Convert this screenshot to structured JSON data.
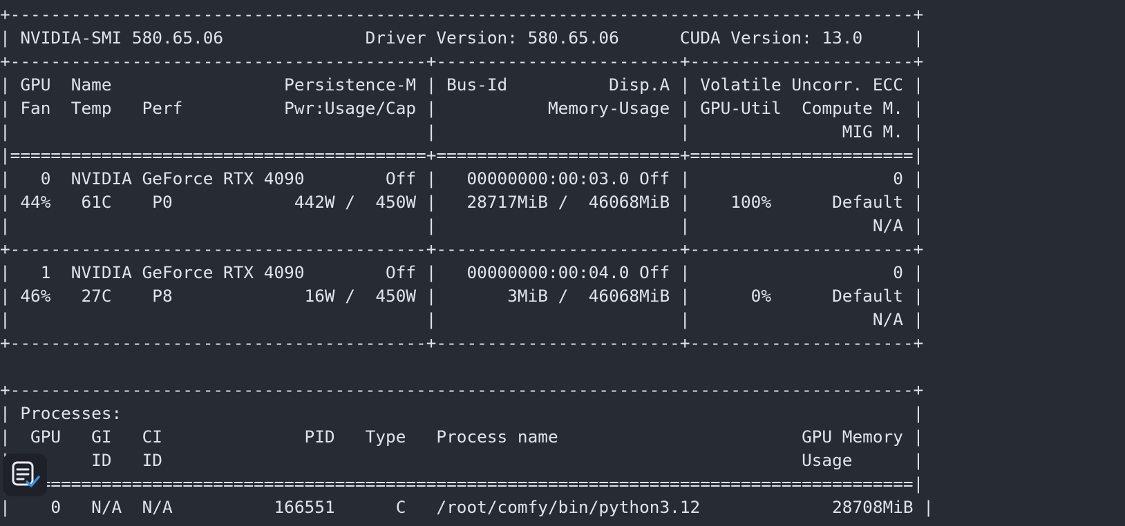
{
  "terminal": {
    "lines": [
      "+-----------------------------------------------------------------------------------------+",
      "| NVIDIA-SMI 580.65.06              Driver Version: 580.65.06      CUDA Version: 13.0     |",
      "+-----------------------------------------+------------------------+----------------------+",
      "| GPU  Name                 Persistence-M | Bus-Id          Disp.A | Volatile Uncorr. ECC |",
      "| Fan  Temp   Perf          Pwr:Usage/Cap |           Memory-Usage | GPU-Util  Compute M. |",
      "|                                         |                        |               MIG M. |",
      "|=========================================+========================+======================|",
      "|   0  NVIDIA GeForce RTX 4090        Off |   00000000:00:03.0 Off |                    0 |",
      "| 44%   61C    P0            442W /  450W |   28717MiB /  46068MiB |    100%      Default |",
      "|                                         |                        |                  N/A |",
      "+-----------------------------------------+------------------------+----------------------+",
      "|   1  NVIDIA GeForce RTX 4090        Off |   00000000:00:04.0 Off |                    0 |",
      "| 46%   27C    P8             16W /  450W |       3MiB /  46068MiB |      0%      Default |",
      "|                                         |                        |                  N/A |",
      "+-----------------------------------------+------------------------+----------------------+",
      "",
      "+-----------------------------------------------------------------------------------------+",
      "| Processes:                                                                              |",
      "|  GPU   GI   CI              PID   Type   Process name                        GPU Memory |",
      "|        ID   ID                                                               Usage      |",
      "|=========================================================================================|",
      "|    0   N/A  N/A          166551      C   /root/comfy/bin/python3.12             28708MiB |",
      "+-----------------------------------------------------------------------------------------+"
    ]
  },
  "overlay": {
    "icon": "copy-text-icon",
    "accent_color": "#3b8fe0"
  }
}
